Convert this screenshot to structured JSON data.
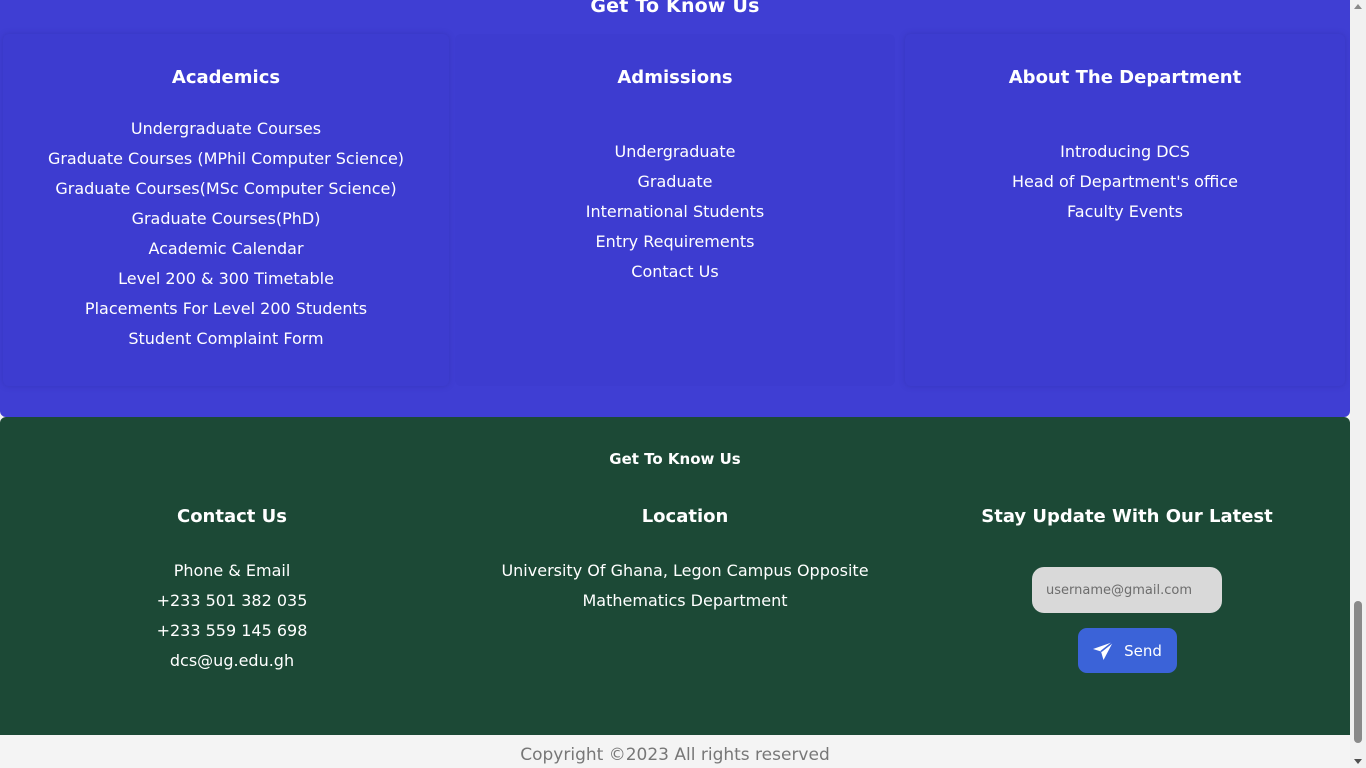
{
  "top_section": {
    "heading": "Get To Know Us",
    "columns": [
      {
        "title": "Academics",
        "links": [
          "Undergraduate Courses",
          "Graduate Courses (MPhil Computer Science)",
          "Graduate Courses(MSc Computer Science)",
          "Graduate Courses(PhD)",
          "Academic Calendar",
          "Level 200 & 300 Timetable",
          "Placements For Level 200 Students",
          "Student Complaint Form"
        ]
      },
      {
        "title": "Admissions",
        "links": [
          "Undergraduate",
          "Graduate",
          "International Students",
          "Entry Requirements",
          "Contact Us"
        ]
      },
      {
        "title": "About The Department",
        "links": [
          "Introducing DCS",
          "Head of Department's office",
          "Faculty Events"
        ]
      }
    ]
  },
  "footer_section": {
    "heading": "Get To Know Us",
    "contact": {
      "title": "Contact Us",
      "lines": [
        "Phone & Email",
        "+233 501 382 035",
        "+233 559 145 698",
        "dcs@ug.edu.gh"
      ]
    },
    "location": {
      "title": "Location",
      "lines": [
        "University Of Ghana, Legon Campus Opposite",
        "Mathematics Department"
      ]
    },
    "newsletter": {
      "title": "Stay Update With Our Latest",
      "email_placeholder": "username@gmail.com",
      "email_value": "",
      "send_label": "Send",
      "send_icon": "paper-plane-icon"
    }
  },
  "copyright": "Copyright ©2023 All rights reserved",
  "colors": {
    "top_background": "#3f3ed3",
    "footer_background": "#1c4936",
    "send_button": "#3b63d8",
    "page_background": "#f4f4f4"
  }
}
